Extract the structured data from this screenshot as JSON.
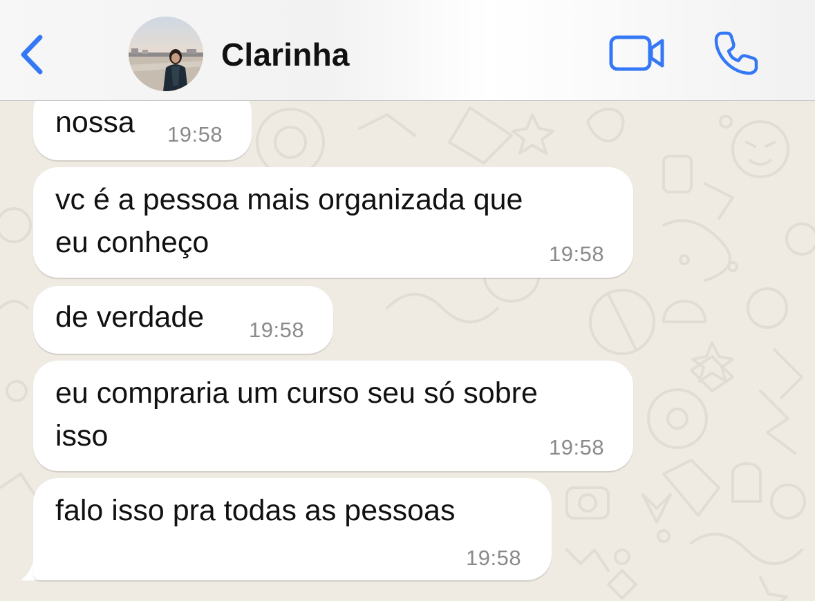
{
  "header": {
    "contact_name": "Clarinha",
    "back_icon": "chevron-left-icon",
    "video_icon": "video-camera-icon",
    "call_icon": "phone-icon",
    "accent_color": "#3478f6"
  },
  "messages": [
    {
      "line1": "nossa",
      "line2": "",
      "time": "19:58"
    },
    {
      "line1": "vc é a pessoa mais organizada que",
      "line2": "eu conheço",
      "time": "19:58"
    },
    {
      "line1": "de verdade",
      "line2": "",
      "time": "19:58"
    },
    {
      "line1": "eu compraria um curso seu só sobre",
      "line2": "isso",
      "time": "19:58"
    },
    {
      "line1": "falo isso pra todas as pessoas",
      "line2": "",
      "time": "19:58"
    }
  ],
  "colors": {
    "chat_background": "#efeae2",
    "bubble_background": "#ffffff",
    "timestamp": "#8a8a8a"
  }
}
